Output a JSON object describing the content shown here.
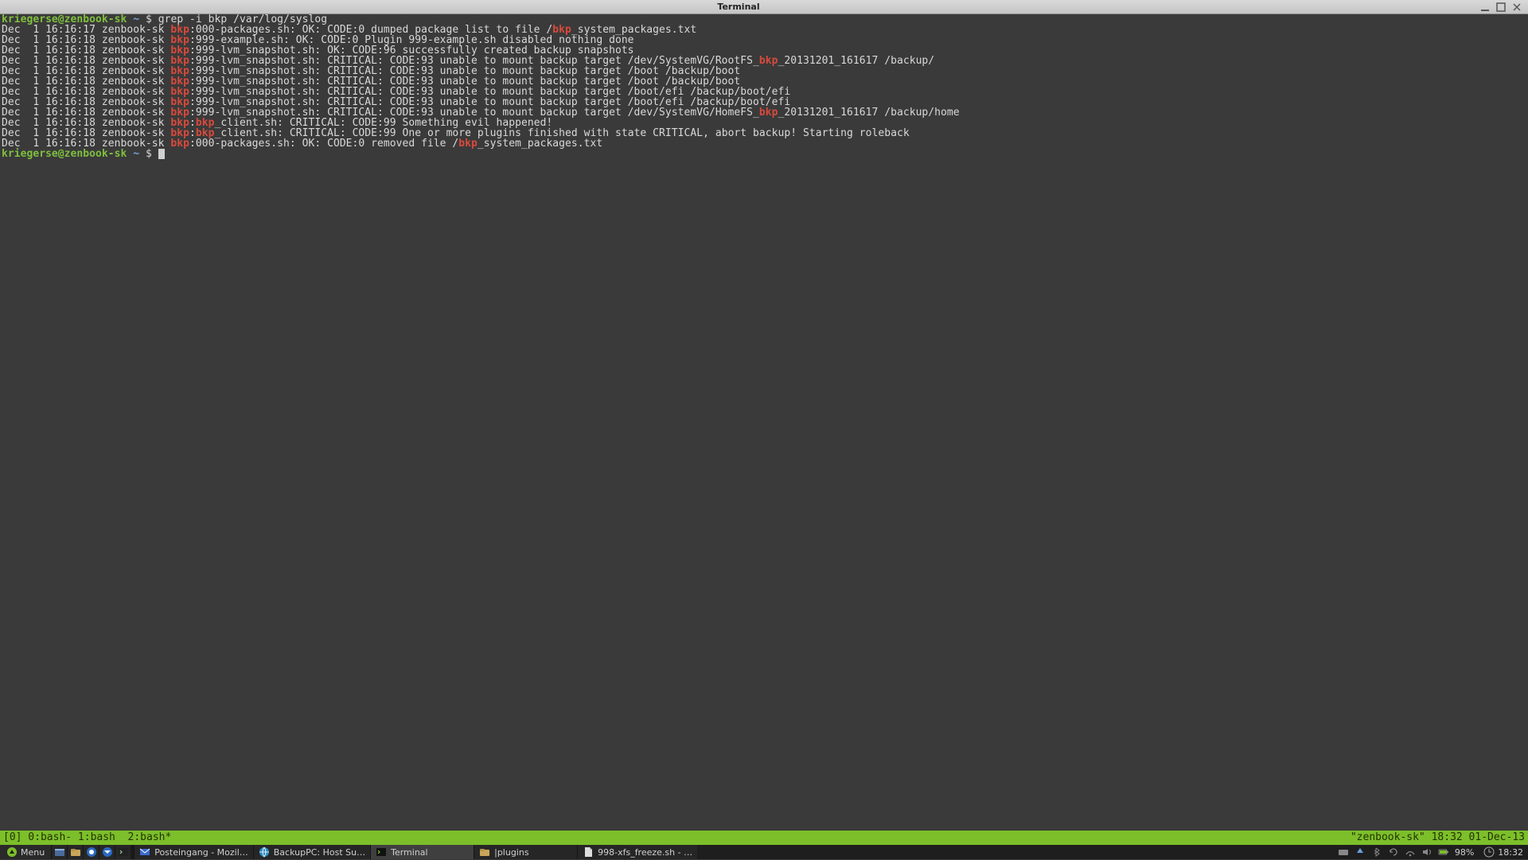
{
  "window": {
    "title": "Terminal"
  },
  "prompt": {
    "userhost": "kriegerse@zenbook-sk",
    "cwd": "~",
    "symbol": "$"
  },
  "command": "grep -i bkp /var/log/syslog",
  "loglines": [
    {
      "pre": "Dec  1 16:16:17 zenbook-sk ",
      "hl0": "bkp",
      "m0": ":000-packages.sh: OK: CODE:0 dumped package list to file /",
      "hl1": "bkp",
      "m1": "_system_packages.txt"
    },
    {
      "pre": "Dec  1 16:16:18 zenbook-sk ",
      "hl0": "bkp",
      "m0": ":999-example.sh: OK: CODE:0 Plugin 999-example.sh disabled nothing done"
    },
    {
      "pre": "Dec  1 16:16:18 zenbook-sk ",
      "hl0": "bkp",
      "m0": ":999-lvm_snapshot.sh: OK: CODE:96 successfully created backup snapshots"
    },
    {
      "pre": "Dec  1 16:16:18 zenbook-sk ",
      "hl0": "bkp",
      "m0": ":999-lvm_snapshot.sh: CRITICAL: CODE:93 unable to mount backup target /dev/SystemVG/RootFS_",
      "hl1": "bkp",
      "m1": "_20131201_161617 /backup/"
    },
    {
      "pre": "Dec  1 16:16:18 zenbook-sk ",
      "hl0": "bkp",
      "m0": ":999-lvm_snapshot.sh: CRITICAL: CODE:93 unable to mount backup target /boot /backup/boot"
    },
    {
      "pre": "Dec  1 16:16:18 zenbook-sk ",
      "hl0": "bkp",
      "m0": ":999-lvm_snapshot.sh: CRITICAL: CODE:93 unable to mount backup target /boot /backup/boot"
    },
    {
      "pre": "Dec  1 16:16:18 zenbook-sk ",
      "hl0": "bkp",
      "m0": ":999-lvm_snapshot.sh: CRITICAL: CODE:93 unable to mount backup target /boot/efi /backup/boot/efi"
    },
    {
      "pre": "Dec  1 16:16:18 zenbook-sk ",
      "hl0": "bkp",
      "m0": ":999-lvm_snapshot.sh: CRITICAL: CODE:93 unable to mount backup target /boot/efi /backup/boot/efi"
    },
    {
      "pre": "Dec  1 16:16:18 zenbook-sk ",
      "hl0": "bkp",
      "m0": ":999-lvm_snapshot.sh: CRITICAL: CODE:93 unable to mount backup target /dev/SystemVG/HomeFS_",
      "hl1": "bkp",
      "m1": "_20131201_161617 /backup/home"
    },
    {
      "pre": "Dec  1 16:16:18 zenbook-sk ",
      "hl0": "bkp",
      "m0": ":",
      "hl1": "bkp",
      "m1": "_client.sh: CRITICAL: CODE:99 Something evil happened!"
    },
    {
      "pre": "Dec  1 16:16:18 zenbook-sk ",
      "hl0": "bkp",
      "m0": ":",
      "hl1": "bkp",
      "m1": "_client.sh: CRITICAL: CODE:99 One or more plugins finished with state CRITICAL, abort backup! Starting roleback"
    },
    {
      "pre": "Dec  1 16:16:18 zenbook-sk ",
      "hl0": "bkp",
      "m0": ":000-packages.sh: OK: CODE:0 removed file /",
      "hl1": "bkp",
      "m1": "_system_packages.txt"
    }
  ],
  "tmux": {
    "left": "[0] 0:bash- 1:bash  2:bash*",
    "right": "\"zenbook-sk\" 18:32 01-Dec-13"
  },
  "taskbar": {
    "menu": "Menu",
    "tasks": [
      {
        "id": "mail",
        "label": "Posteingang - Mozil…",
        "icon": "mail-icon"
      },
      {
        "id": "backuppc",
        "label": "BackupPC: Host Su…",
        "icon": "globe-icon"
      },
      {
        "id": "terminal",
        "label": "Terminal",
        "icon": "terminal-icon",
        "active": true
      },
      {
        "id": "plugins",
        "label": "|plugins",
        "icon": "folder-icon"
      },
      {
        "id": "editor",
        "label": "998-xfs_freeze.sh - …",
        "icon": "document-icon"
      }
    ],
    "battery": "98%",
    "clock": "18:32"
  }
}
